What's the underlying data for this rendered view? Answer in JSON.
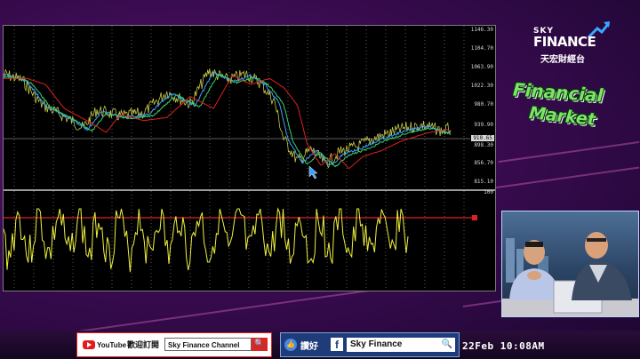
{
  "terminal": {
    "price_axis": [
      "1146.30",
      "1104.70",
      "1063.90",
      "1022.30",
      "980.70",
      "939.90",
      "898.30",
      "856.70",
      "815.10"
    ],
    "current_price": "910.65",
    "oscillator_axis_top": "100"
  },
  "brand": {
    "sky": "SKY",
    "finance": "FINANCE",
    "chinese": "天宏財經台"
  },
  "show_title": {
    "line1": "Financial",
    "line2": "Market"
  },
  "youtube": {
    "logo_text": "YouTube",
    "subscribe": "歡迎訂閱",
    "channel": "Sky Finance Channel"
  },
  "facebook": {
    "like": "讚好",
    "page_name": "Sky Finance"
  },
  "clock": "22Feb 10:08AM",
  "colors": {
    "background": "#3a0b50",
    "price_ma_fast": "#3fa0ff",
    "price_ma_mid": "#3ad16b",
    "price_ma_slow": "#e02020",
    "price_line": "#c8c84a",
    "oscillator": "#f0f040",
    "oscillator_level": "#e02020"
  },
  "icons": [
    "search-icon",
    "like-icon",
    "facebook-icon",
    "youtube-icon",
    "cursor-arrow-icon",
    "trend-arrow-icon"
  ]
}
